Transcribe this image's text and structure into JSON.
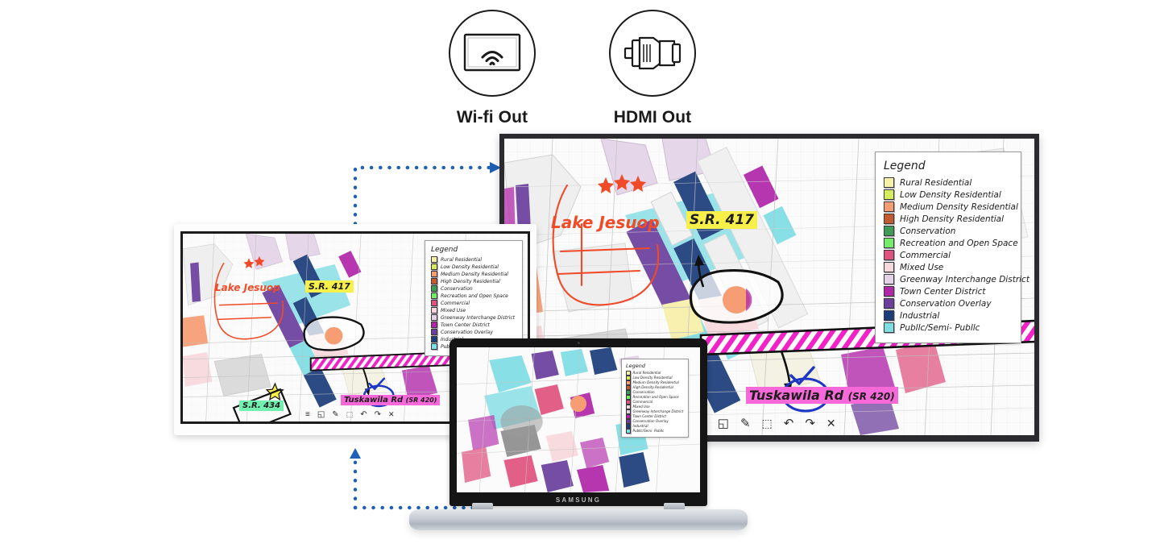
{
  "outputs": [
    {
      "label": "Wi-fi Out",
      "icon": "wifi-screen-icon"
    },
    {
      "label": "HDMI Out",
      "icon": "hdmi-connector-icon"
    }
  ],
  "legend": {
    "title": "Legend",
    "items": [
      {
        "label": "Rural Residential",
        "color": "#f7f0a8"
      },
      {
        "label": "Low Density Residential",
        "color": "#d6ec5e"
      },
      {
        "label": "Medium Density Residential",
        "color": "#f79d74"
      },
      {
        "label": "High Density Residential",
        "color": "#c25b30"
      },
      {
        "label": "Conservation",
        "color": "#3f9b55"
      },
      {
        "label": "Recreation and Open Space",
        "color": "#74ee6a"
      },
      {
        "label": "Commercial",
        "color": "#e0527f"
      },
      {
        "label": "Mixed Use",
        "color": "#f7d9dd"
      },
      {
        "label": "Greenway Interchange District",
        "color": "#e4d3e8"
      },
      {
        "label": "Town Center District",
        "color": "#b026a9"
      },
      {
        "label": "Conservation Overlay",
        "color": "#6b3f9e"
      },
      {
        "label": "Industrial",
        "color": "#1b3d7a"
      },
      {
        "label": "Publlc/Semi- Publlc",
        "color": "#7fdde4"
      }
    ]
  },
  "map_annotations": {
    "lake": "Lake Jesuop",
    "sr417": "S.R. 417",
    "sr434": "S.R. 434",
    "tuskawila": "Tuskawila Rd",
    "tuskawila_sub": "(SR 420)",
    "highlight_sr417": "#f7ef4a",
    "highlight_sr434": "#72f0b0",
    "highlight_tuskawila": "#f768d8",
    "lake_color": "#f04a28",
    "ink_color": "#1a1a1a",
    "check_color": "#1d37c4"
  },
  "toolbar": {
    "icons": [
      {
        "name": "menu-icon",
        "glyph": "≡"
      },
      {
        "name": "note-icon",
        "glyph": "◱"
      },
      {
        "name": "pen-icon",
        "glyph": "✎"
      },
      {
        "name": "select-icon",
        "glyph": "⬚"
      },
      {
        "name": "undo-icon",
        "glyph": "↶"
      },
      {
        "name": "redo-icon",
        "glyph": "↷"
      },
      {
        "name": "close-icon",
        "glyph": "✕"
      }
    ]
  },
  "laptop": {
    "brand": "SAMSUNG"
  },
  "connectors": {
    "color": "#1f5fb4",
    "wifi_path_name": "wifi-out-connector",
    "hdmi_path_name": "hdmi-out-connector"
  }
}
